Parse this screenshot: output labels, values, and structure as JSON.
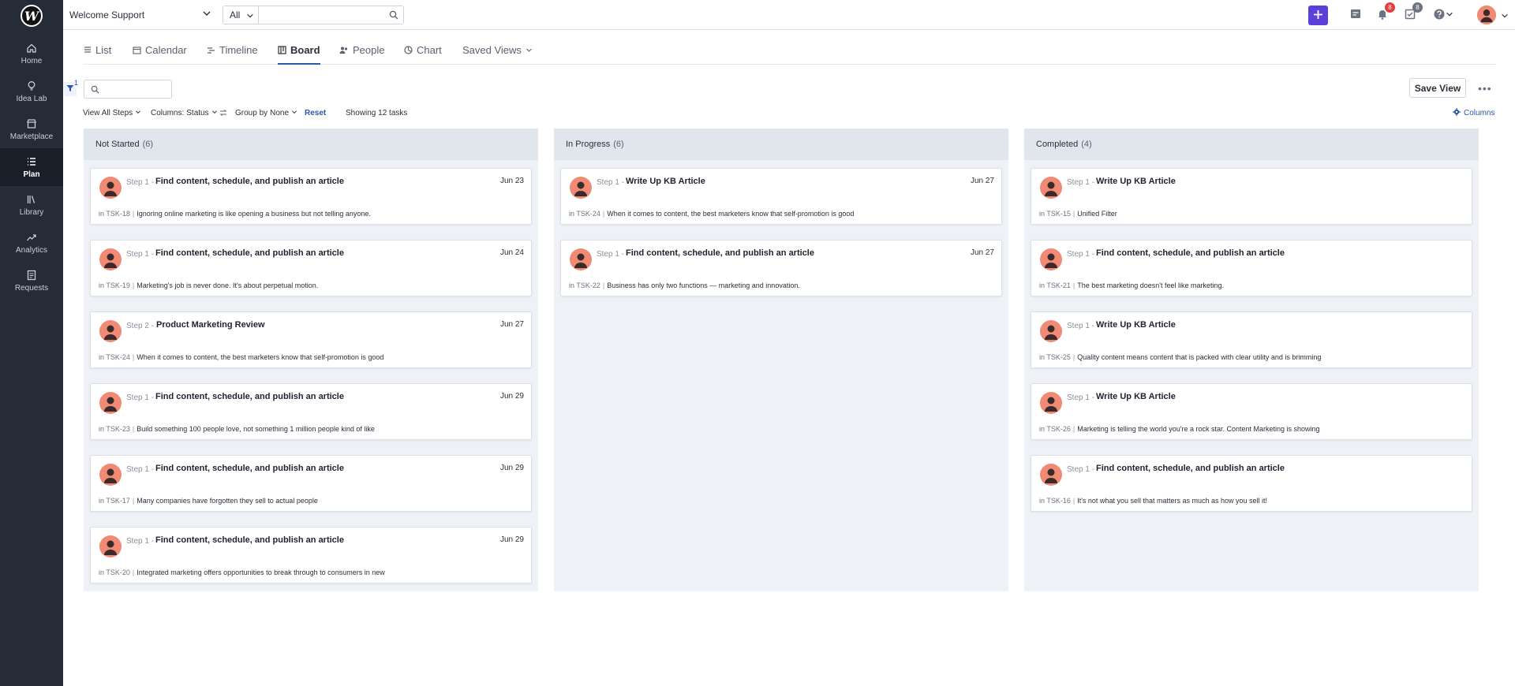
{
  "sidebar": {
    "logo": "W",
    "items": [
      {
        "label": "Home",
        "icon": "home-icon"
      },
      {
        "label": "Idea Lab",
        "icon": "lightbulb-icon"
      },
      {
        "label": "Marketplace",
        "icon": "store-icon"
      },
      {
        "label": "Plan",
        "icon": "list-icon",
        "active": true
      },
      {
        "label": "Library",
        "icon": "library-icon"
      },
      {
        "label": "Analytics",
        "icon": "trend-icon"
      },
      {
        "label": "Requests",
        "icon": "requests-icon"
      }
    ]
  },
  "topbar": {
    "workspace": "Welcome Support",
    "scope": "All",
    "search_placeholder": "",
    "notifications_count": "8",
    "tasks_count": "8"
  },
  "tabs": [
    "List",
    "Calendar",
    "Timeline",
    "Board",
    "People",
    "Chart",
    "Saved Views"
  ],
  "active_tab": "Board",
  "filter": {
    "count": "1",
    "search_placeholder": ""
  },
  "controls": {
    "view_steps": "View All Steps",
    "columns_label": "Columns:",
    "columns_value": "Status",
    "group_label": "Group by",
    "group_value": "None",
    "reset": "Reset",
    "showing": "Showing 12 tasks",
    "columns_link": "Columns",
    "save_view": "Save View"
  },
  "columns": [
    {
      "name": "Not Started",
      "count": "(6)",
      "cards": [
        {
          "step": "Step 1 -",
          "title": "Find content, schedule, and publish an article",
          "date": "Jun 23",
          "tsk": "TSK-18",
          "desc": "Ignoring online marketing is like opening a business but not telling anyone."
        },
        {
          "step": "Step 1 -",
          "title": "Find content, schedule, and publish an article",
          "date": "Jun 24",
          "tsk": "TSK-19",
          "desc": "Marketing's job is never done. It's about perpetual motion."
        },
        {
          "step": "Step 2 -",
          "title": "Product Marketing Review",
          "date": "Jun 27",
          "tsk": "TSK-24",
          "desc": "When it comes to content, the best marketers know that self-promotion is good"
        },
        {
          "step": "Step 1 -",
          "title": "Find content, schedule, and publish an article",
          "date": "Jun 29",
          "tsk": "TSK-23",
          "desc": "Build something 100 people love, not something 1 million people kind of like"
        },
        {
          "step": "Step 1 -",
          "title": "Find content, schedule, and publish an article",
          "date": "Jun 29",
          "tsk": "TSK-17",
          "desc": "Many companies have forgotten they sell to actual people"
        },
        {
          "step": "Step 1 -",
          "title": "Find content, schedule, and publish an article",
          "date": "Jun 29",
          "tsk": "TSK-20",
          "desc": "Integrated marketing offers opportunities to break through to consumers in new"
        }
      ]
    },
    {
      "name": "In Progress",
      "count": "(6)",
      "cards": [
        {
          "step": "Step 1 -",
          "title": "Write Up KB Article",
          "date": "Jun 27",
          "tsk": "TSK-24",
          "desc": "When it comes to content, the best marketers know that self-promotion is good"
        },
        {
          "step": "Step 1 -",
          "title": "Find content, schedule, and publish an article",
          "date": "Jun 27",
          "tsk": "TSK-22",
          "desc": "Business has only two functions — marketing and innovation."
        }
      ]
    },
    {
      "name": "Completed",
      "count": "(4)",
      "cards": [
        {
          "step": "Step 1 -",
          "title": "Write Up KB Article",
          "date": "",
          "tsk": "TSK-15",
          "desc": "Unified Filter"
        },
        {
          "step": "Step 1 -",
          "title": "Find content, schedule, and publish an article",
          "date": "",
          "tsk": "TSK-21",
          "desc": "The best marketing doesn't feel like marketing."
        },
        {
          "step": "Step 1 -",
          "title": "Write Up KB Article",
          "date": "",
          "tsk": "TSK-25",
          "desc": "Quality content means content that is packed with clear utility and is brimming"
        },
        {
          "step": "Step 1 -",
          "title": "Write Up KB Article",
          "date": "",
          "tsk": "TSK-26",
          "desc": "Marketing is telling the world you're a rock star. Content Marketing is showing"
        },
        {
          "step": "Step 1 -",
          "title": "Find content, schedule, and publish an article",
          "date": "",
          "tsk": "TSK-16",
          "desc": "It's not what you sell that matters as much as how you sell it!"
        }
      ]
    }
  ],
  "colors": {
    "accent": "#5b3fd9",
    "link": "#2b57a6",
    "sidebar": "#262b38"
  }
}
